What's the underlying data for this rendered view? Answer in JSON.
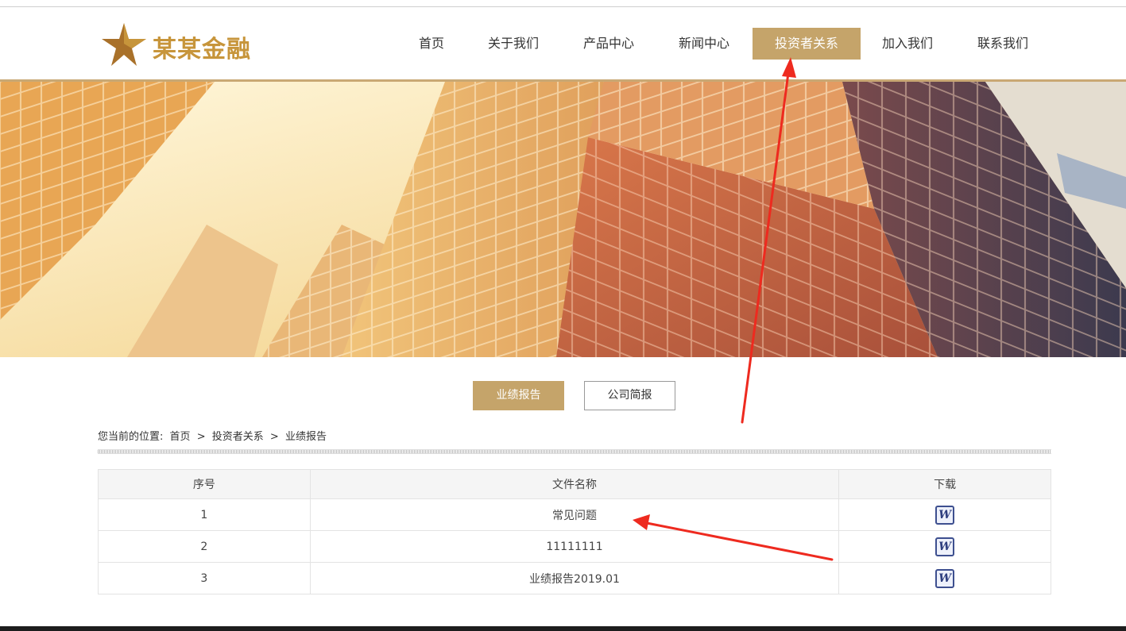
{
  "header": {
    "logo_text": "某某金融",
    "nav": [
      {
        "label": "首页",
        "active": false
      },
      {
        "label": "关于我们",
        "active": false
      },
      {
        "label": "产品中心",
        "active": false
      },
      {
        "label": "新闻中心",
        "active": false
      },
      {
        "label": "投资者关系",
        "active": true
      },
      {
        "label": "加入我们",
        "active": false
      },
      {
        "label": "联系我们",
        "active": false
      }
    ]
  },
  "subtabs": [
    {
      "label": "业绩报告",
      "active": true
    },
    {
      "label": "公司简报",
      "active": false
    }
  ],
  "breadcrumb": {
    "prefix": "您当前的位置:",
    "items": [
      "首页",
      "投资者关系",
      "业绩报告"
    ],
    "separator": ">"
  },
  "table": {
    "headers": [
      "序号",
      "文件名称",
      "下载"
    ],
    "rows": [
      {
        "index": "1",
        "name": "常见问题"
      },
      {
        "index": "2",
        "name": "11111111"
      },
      {
        "index": "3",
        "name": "业绩报告2019.01"
      }
    ]
  },
  "colors": {
    "accent": "#c5a46a",
    "logo": "#c7953b",
    "annotation_arrow": "#ee2a1f",
    "word_icon": "#3d4f8f"
  },
  "icons": {
    "logo": "star-logo-icon",
    "download": "word-document-icon"
  }
}
